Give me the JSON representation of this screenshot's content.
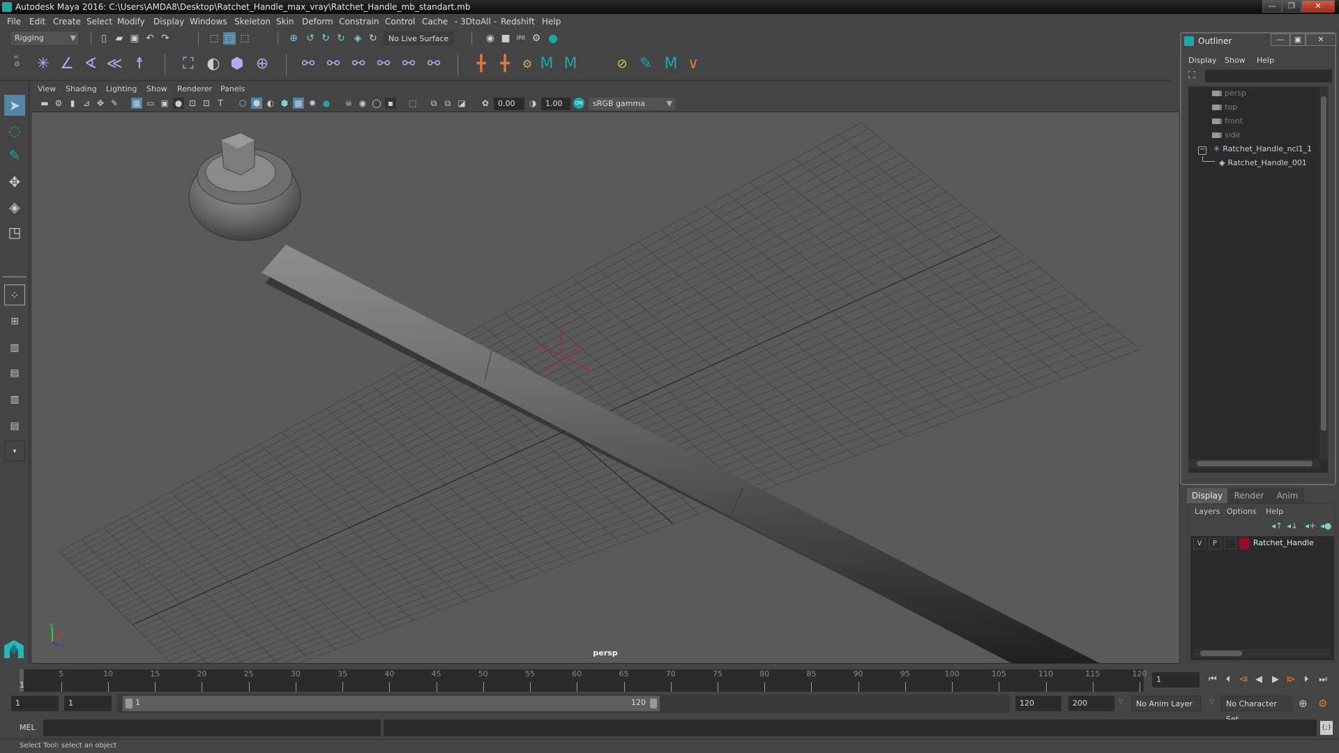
{
  "window": {
    "title": "Autodesk Maya 2016: C:\\Users\\AMDA8\\Desktop\\Ratchet_Handle_max_vray\\Ratchet_Handle_mb_standart.mb",
    "minimize": "—",
    "restore": "❐",
    "close": "✕"
  },
  "menubar": [
    "File",
    "Edit",
    "Create",
    "Select",
    "Modify",
    "Display",
    "Windows",
    "Skeleton",
    "Skin",
    "Deform",
    "Constrain",
    "Control",
    "Cache",
    "- 3DtoAll -",
    "Redshift",
    "Help"
  ],
  "statusline": {
    "menu_set": "Rigging",
    "live_surface": "No Live Surface"
  },
  "viewport": {
    "menu": [
      "View",
      "Shading",
      "Lighting",
      "Show",
      "Renderer",
      "Panels"
    ],
    "exposure": "0.00",
    "gamma": "1.00",
    "color_space": "sRGB gamma",
    "color_mgmt_badge": "ON",
    "camera_label": "persp",
    "axis": {
      "x": "x",
      "y": "y",
      "z": "z"
    }
  },
  "outliner": {
    "title": "Outliner",
    "menu": [
      "Display",
      "Show",
      "Help"
    ],
    "search_value": "",
    "items": [
      {
        "label": "persp",
        "type": "camera"
      },
      {
        "label": "top",
        "type": "camera"
      },
      {
        "label": "front",
        "type": "camera"
      },
      {
        "label": "side",
        "type": "camera"
      },
      {
        "label": "Ratchet_Handle_ncl1_1",
        "type": "group",
        "expanded": true
      },
      {
        "label": "Ratchet_Handle_001",
        "type": "mesh"
      }
    ]
  },
  "layers": {
    "tabs": [
      "Display",
      "Render",
      "Anim"
    ],
    "active_tab": "Display",
    "menu": [
      "Layers",
      "Options",
      "Help"
    ],
    "rows": [
      {
        "visible": "V",
        "playback": "P",
        "color": "#9b0a2a",
        "name": "Ratchet_Handle"
      }
    ]
  },
  "timeline": {
    "ticks": [
      5,
      10,
      15,
      20,
      25,
      30,
      35,
      40,
      45,
      50,
      55,
      60,
      65,
      70,
      75,
      80,
      85,
      90,
      95,
      100,
      105,
      110,
      115,
      120
    ],
    "current_frame_marker": "1",
    "current_frame": "1",
    "range_start": "1",
    "playback_start": "1",
    "range_slider_start": "1",
    "range_slider_end": "120",
    "playback_end": "120",
    "range_end": "200",
    "anim_layer": "No Anim Layer",
    "character_set": "No Character Set"
  },
  "commandline": {
    "lang": "MEL",
    "input": "",
    "result": ""
  },
  "helpline": "Select Tool: select an object",
  "colors": {
    "accent": "#1fa7a8",
    "layer_color": "#9b0a2a",
    "playback_key": "#e07a3a"
  }
}
